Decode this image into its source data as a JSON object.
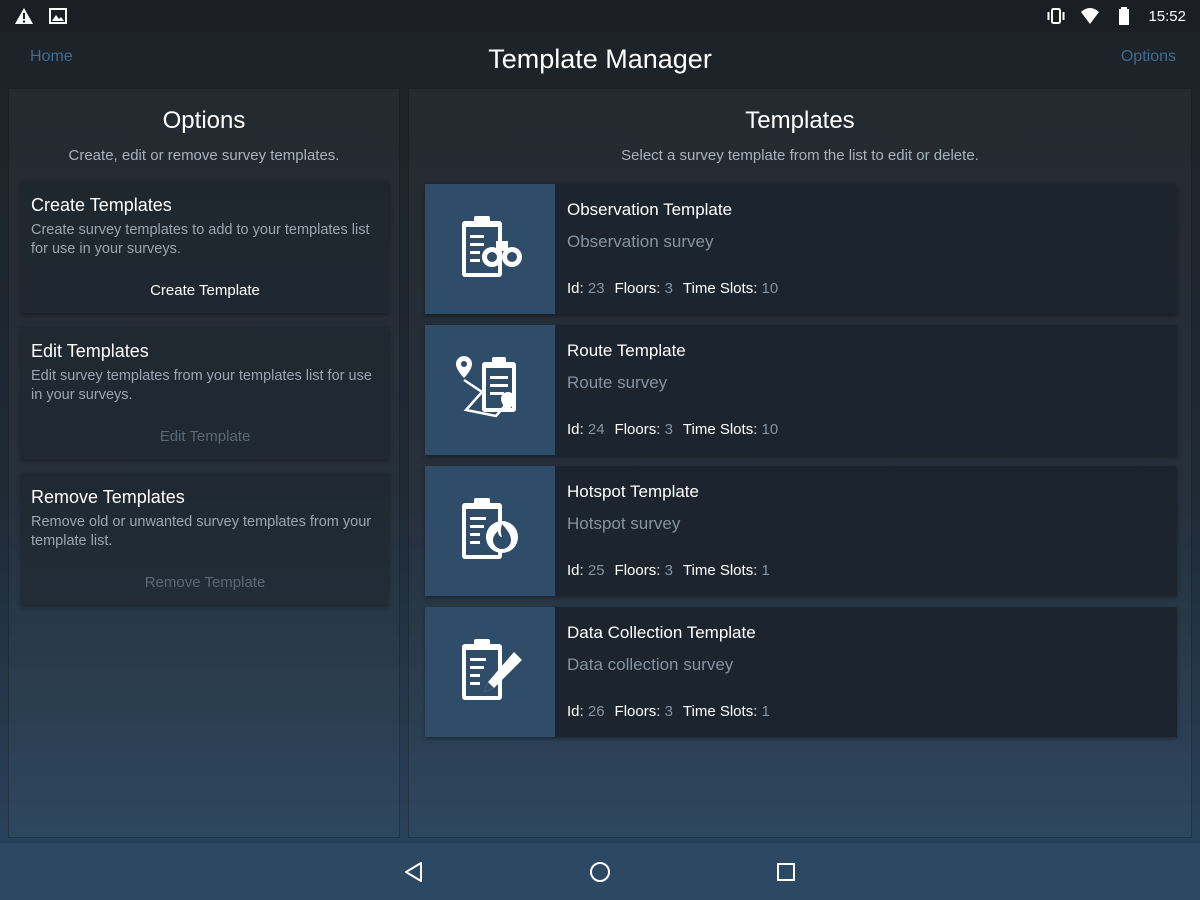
{
  "status_bar": {
    "left_icons": [
      "warning-icon",
      "image-icon"
    ],
    "right_icons": [
      "vibrate-icon",
      "wifi-icon",
      "battery-icon"
    ],
    "time": "15:52"
  },
  "header": {
    "title": "Template Manager",
    "left_link": "Home",
    "right_link": "Options"
  },
  "options_panel": {
    "title": "Options",
    "subtitle": "Create, edit or remove survey templates.",
    "cards": [
      {
        "title": "Create Templates",
        "description": "Create survey templates to add to your templates list for use in your surveys.",
        "button": "Create Template",
        "enabled": true
      },
      {
        "title": "Edit Templates",
        "description": "Edit survey templates from your templates list for use in your surveys.",
        "button": "Edit Template",
        "enabled": false
      },
      {
        "title": "Remove Templates",
        "description": "Remove old or unwanted survey templates from your template list.",
        "button": "Remove Template",
        "enabled": false
      }
    ]
  },
  "templates_panel": {
    "title": "Templates",
    "subtitle": "Select a survey template from the list to edit or delete.",
    "labels": {
      "id": "Id:",
      "floors": "Floors:",
      "time_slots": "Time Slots:"
    },
    "items": [
      {
        "name": "Observation Template",
        "description": "Observation survey",
        "id": "23",
        "floors": "3",
        "time_slots": "10",
        "icon": "clipboard-binoculars-icon"
      },
      {
        "name": "Route Template",
        "description": "Route survey",
        "id": "24",
        "floors": "3",
        "time_slots": "10",
        "icon": "clipboard-route-icon"
      },
      {
        "name": "Hotspot Template",
        "description": "Hotspot survey",
        "id": "25",
        "floors": "3",
        "time_slots": "1",
        "icon": "clipboard-flame-icon"
      },
      {
        "name": "Data Collection Template",
        "description": "Data collection survey",
        "id": "26",
        "floors": "3",
        "time_slots": "1",
        "icon": "clipboard-pen-icon"
      }
    ]
  },
  "nav_bar": {
    "buttons": [
      "back-icon",
      "home-icon",
      "recents-icon"
    ]
  },
  "colors": {
    "accent_link": "#3e6c92",
    "thumb_bg": "#2f4c68",
    "nav_bar_bg": "#2d4863"
  }
}
